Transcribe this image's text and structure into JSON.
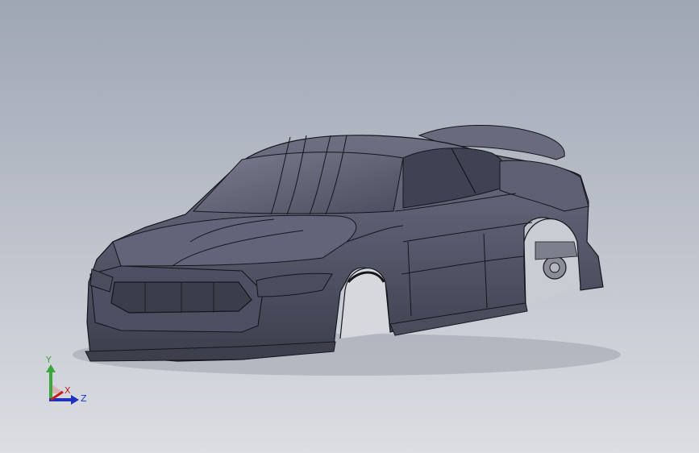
{
  "viewport": {
    "background_top": "#9fa6b4",
    "background_bottom": "#dcdee3"
  },
  "model": {
    "body_color": "#5a5c6e",
    "edge_color": "#15161c"
  },
  "triad": {
    "y_label": "Y",
    "x_label": "X",
    "z_label": "Z",
    "y_color": "#3aa83a",
    "x_color": "#c02020",
    "z_color": "#2030c0"
  }
}
